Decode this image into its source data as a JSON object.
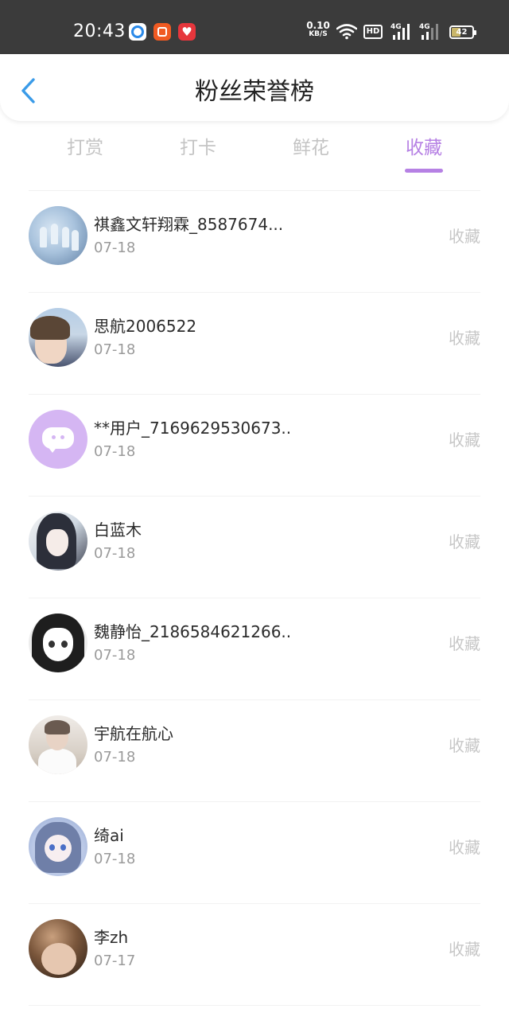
{
  "status_bar": {
    "time": "20:43",
    "net_speed_value": "0.10",
    "net_speed_unit": "KB/S",
    "hd_label": "HD",
    "signal1_label": "4G",
    "signal2_label": "4G",
    "battery_level": "42",
    "battery_fraction": 0.42
  },
  "header": {
    "title": "粉丝荣誉榜"
  },
  "tabs": [
    {
      "label": "打赏",
      "active": false
    },
    {
      "label": "打卡",
      "active": false
    },
    {
      "label": "鲜花",
      "active": false
    },
    {
      "label": "收藏",
      "active": true
    }
  ],
  "colors": {
    "accent": "#b681e4",
    "inactive_tab": "#c4c4c4",
    "status_bar_bg": "#3b3b3b"
  },
  "fans": [
    {
      "name": "祺鑫文轩翔霖_8587674...",
      "date": "07-18",
      "tag": "收藏"
    },
    {
      "name": "思航2006522",
      "date": "07-18",
      "tag": "收藏"
    },
    {
      "name": "**用户_7169629530673...",
      "date": "07-18",
      "tag": "收藏"
    },
    {
      "name": "白蓝木",
      "date": "07-18",
      "tag": "收藏"
    },
    {
      "name": "魏静怡_2186584621266...",
      "date": "07-18",
      "tag": "收藏"
    },
    {
      "name": "宇航在航心",
      "date": "07-18",
      "tag": "收藏"
    },
    {
      "name": "绮ai",
      "date": "07-18",
      "tag": "收藏"
    },
    {
      "name": "李zh",
      "date": "07-17",
      "tag": "收藏"
    }
  ]
}
